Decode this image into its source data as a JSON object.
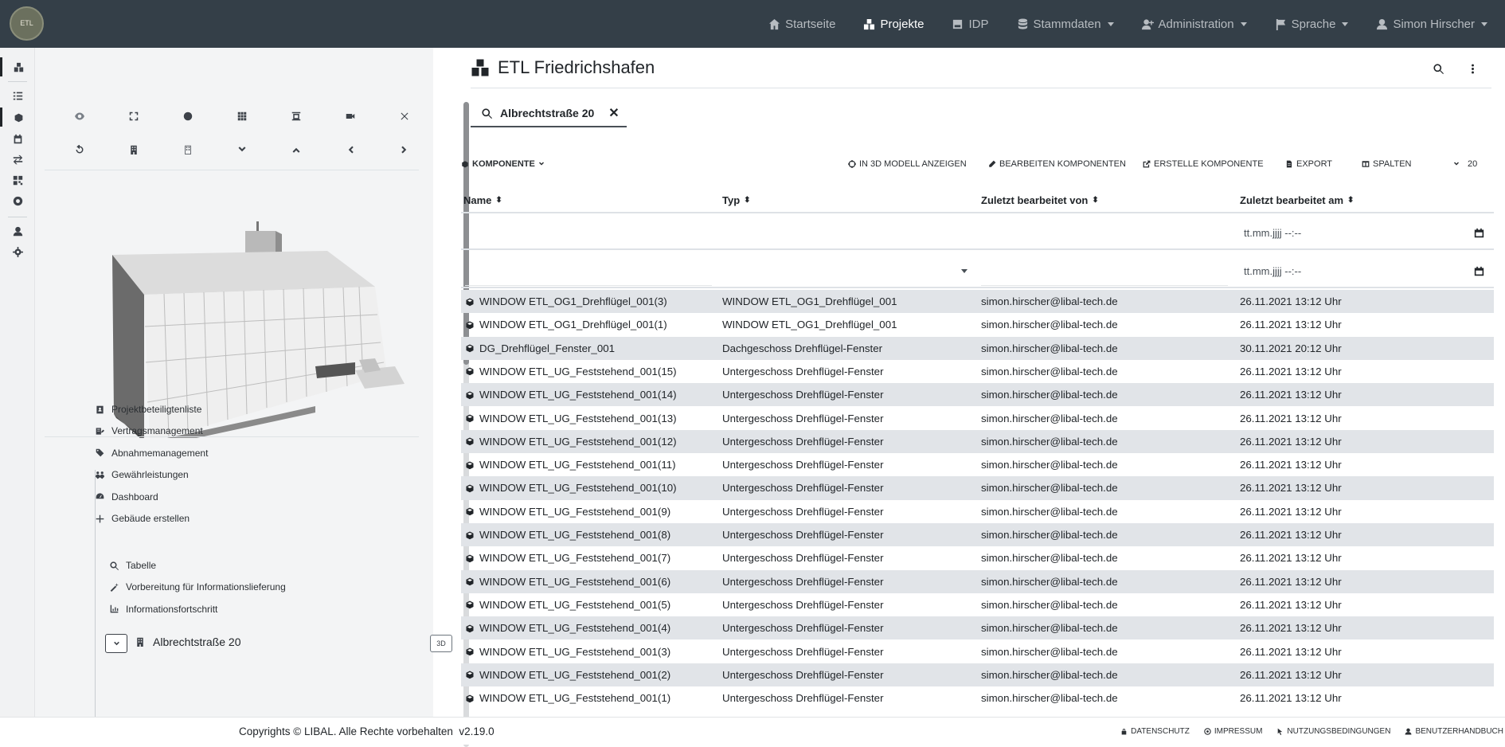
{
  "navbar": {
    "logo_text": "ETL",
    "items": [
      {
        "label": "Startseite",
        "icon": "home-icon",
        "dropdown": false,
        "active": false
      },
      {
        "label": "Projekte",
        "icon": "projects-icon",
        "dropdown": false,
        "active": true
      },
      {
        "label": "IDP",
        "icon": "hdd-icon",
        "dropdown": false,
        "active": false
      },
      {
        "label": "Stammdaten",
        "icon": "database-icon",
        "dropdown": true,
        "active": false
      },
      {
        "label": "Administration",
        "icon": "user-plus-icon",
        "dropdown": true,
        "active": false
      },
      {
        "label": "Sprache",
        "icon": "flag-icon",
        "dropdown": true,
        "active": false
      },
      {
        "label": "Simon Hirscher",
        "icon": "user-icon",
        "dropdown": true,
        "active": false
      }
    ]
  },
  "rail": {
    "items": [
      "projects-icon",
      "list-icon",
      "components-icon",
      "calendar-icon",
      "exchange-icon",
      "qrcode-icon",
      "lifering-icon",
      "user-icon",
      "gear-icon"
    ]
  },
  "viewer_toolbar": {
    "row1": [
      "eye-icon",
      "fullscreen-icon",
      "circle-icon",
      "grid-icon",
      "floor-plan-icon",
      "camera-icon",
      "close-icon"
    ],
    "row2": [
      "undo-icon",
      "building-icon",
      "building-outline-icon",
      "chevron-down-icon",
      "chevron-up-icon",
      "chevron-left-icon",
      "chevron-right-icon"
    ]
  },
  "tree": {
    "items": [
      {
        "label": "Projektbeteiligtenliste",
        "icon": "contact-icon"
      },
      {
        "label": "Vertragsmanagement",
        "icon": "contract-icon"
      },
      {
        "label": "Abnahmemanagement",
        "icon": "tags-icon"
      },
      {
        "label": "Gewährleistungen",
        "icon": "people-icon"
      },
      {
        "label": "Dashboard",
        "icon": "dashboard-icon"
      },
      {
        "label": "Gebäude erstellen",
        "icon": "plus-icon"
      }
    ],
    "building": {
      "label": "Albrechtstraße 20",
      "btn_3d": "3D"
    },
    "sub_items": [
      {
        "label": "Tabelle",
        "icon": "search-icon"
      },
      {
        "label": "Vorbereitung für Informationslieferung",
        "icon": "wand-icon"
      },
      {
        "label": "Informationsfortschritt",
        "icon": "chart-icon"
      }
    ]
  },
  "main": {
    "title": "ETL Friedrichshafen",
    "search_tab": "Albrechtstraße 20",
    "toolbar": {
      "komponente": "Komponente",
      "show_3d": "In 3D Modell anzeigen",
      "edit": "Bearbeiten Komponenten",
      "create": "Erstelle Komponente",
      "export": "Export",
      "columns": "Spalten",
      "page_size": "20"
    },
    "columns": [
      "Name",
      "Typ",
      "Zuletzt bearbeitet von",
      "Zuletzt bearbeitet am"
    ],
    "date_placeholder": "tt.mm.jjjj --:--",
    "rows": [
      [
        "WINDOW ETL_OG1_Drehflügel_001(3)",
        "WINDOW ETL_OG1_Drehflügel_001",
        "simon.hirscher@libal-tech.de",
        "26.11.2021 13:12 Uhr"
      ],
      [
        "WINDOW ETL_OG1_Drehflügel_001(1)",
        "WINDOW ETL_OG1_Drehflügel_001",
        "simon.hirscher@libal-tech.de",
        "26.11.2021 13:12 Uhr"
      ],
      [
        "DG_Drehflügel_Fenster_001",
        "Dachgeschoss Drehflügel-Fenster",
        "simon.hirscher@libal-tech.de",
        "30.11.2021 20:12 Uhr"
      ],
      [
        "WINDOW ETL_UG_Feststehend_001(15)",
        "Untergeschoss Drehflügel-Fenster",
        "simon.hirscher@libal-tech.de",
        "26.11.2021 13:12 Uhr"
      ],
      [
        "WINDOW ETL_UG_Feststehend_001(14)",
        "Untergeschoss Drehflügel-Fenster",
        "simon.hirscher@libal-tech.de",
        "26.11.2021 13:12 Uhr"
      ],
      [
        "WINDOW ETL_UG_Feststehend_001(13)",
        "Untergeschoss Drehflügel-Fenster",
        "simon.hirscher@libal-tech.de",
        "26.11.2021 13:12 Uhr"
      ],
      [
        "WINDOW ETL_UG_Feststehend_001(12)",
        "Untergeschoss Drehflügel-Fenster",
        "simon.hirscher@libal-tech.de",
        "26.11.2021 13:12 Uhr"
      ],
      [
        "WINDOW ETL_UG_Feststehend_001(11)",
        "Untergeschoss Drehflügel-Fenster",
        "simon.hirscher@libal-tech.de",
        "26.11.2021 13:12 Uhr"
      ],
      [
        "WINDOW ETL_UG_Feststehend_001(10)",
        "Untergeschoss Drehflügel-Fenster",
        "simon.hirscher@libal-tech.de",
        "26.11.2021 13:12 Uhr"
      ],
      [
        "WINDOW ETL_UG_Feststehend_001(9)",
        "Untergeschoss Drehflügel-Fenster",
        "simon.hirscher@libal-tech.de",
        "26.11.2021 13:12 Uhr"
      ],
      [
        "WINDOW ETL_UG_Feststehend_001(8)",
        "Untergeschoss Drehflügel-Fenster",
        "simon.hirscher@libal-tech.de",
        "26.11.2021 13:12 Uhr"
      ],
      [
        "WINDOW ETL_UG_Feststehend_001(7)",
        "Untergeschoss Drehflügel-Fenster",
        "simon.hirscher@libal-tech.de",
        "26.11.2021 13:12 Uhr"
      ],
      [
        "WINDOW ETL_UG_Feststehend_001(6)",
        "Untergeschoss Drehflügel-Fenster",
        "simon.hirscher@libal-tech.de",
        "26.11.2021 13:12 Uhr"
      ],
      [
        "WINDOW ETL_UG_Feststehend_001(5)",
        "Untergeschoss Drehflügel-Fenster",
        "simon.hirscher@libal-tech.de",
        "26.11.2021 13:12 Uhr"
      ],
      [
        "WINDOW ETL_UG_Feststehend_001(4)",
        "Untergeschoss Drehflügel-Fenster",
        "simon.hirscher@libal-tech.de",
        "26.11.2021 13:12 Uhr"
      ],
      [
        "WINDOW ETL_UG_Feststehend_001(3)",
        "Untergeschoss Drehflügel-Fenster",
        "simon.hirscher@libal-tech.de",
        "26.11.2021 13:12 Uhr"
      ],
      [
        "WINDOW ETL_UG_Feststehend_001(2)",
        "Untergeschoss Drehflügel-Fenster",
        "simon.hirscher@libal-tech.de",
        "26.11.2021 13:12 Uhr"
      ],
      [
        "WINDOW ETL_UG_Feststehend_001(1)",
        "Untergeschoss Drehflügel-Fenster",
        "simon.hirscher@libal-tech.de",
        "26.11.2021 13:12 Uhr"
      ]
    ]
  },
  "footer": {
    "copyright": "Copyrights © LIBAL. Alle Rechte vorbehalten",
    "version": "v2.19.0",
    "links": [
      {
        "label": "Datenschutz",
        "icon": "lock-icon"
      },
      {
        "label": "Impressum",
        "icon": "at-icon"
      },
      {
        "label": "Nutzungsbedingungen",
        "icon": "pointer-icon"
      },
      {
        "label": "Benutzerhandbuch",
        "icon": "user-icon"
      }
    ]
  },
  "colors": {
    "navbar": "#343f48",
    "panel": "#f3f4f5",
    "row_stripe": "#e1e4e8"
  }
}
